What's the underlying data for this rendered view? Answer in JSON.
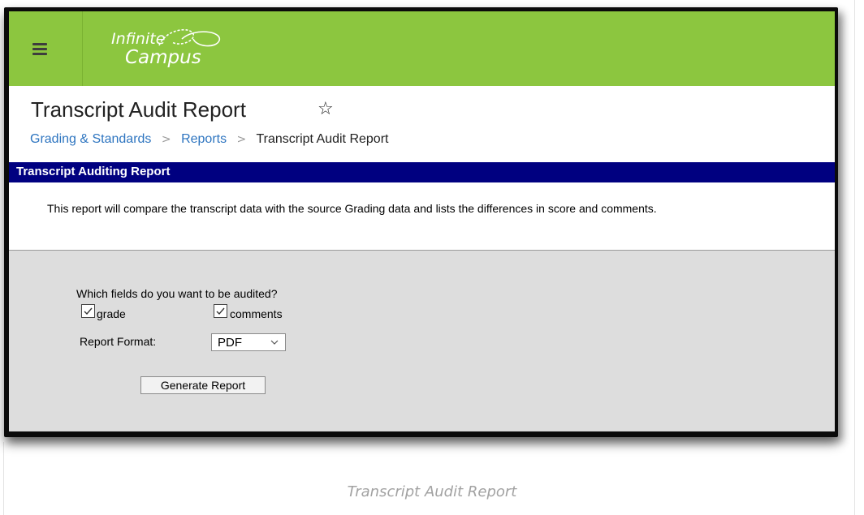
{
  "header": {
    "logo_line1": "Infinite",
    "logo_line2": "Campus"
  },
  "page": {
    "title": "Transcript Audit Report",
    "breadcrumb": [
      "Grading & Standards",
      "Reports",
      "Transcript Audit Report"
    ]
  },
  "section": {
    "title": "Transcript Auditing Report",
    "description": "This report will compare the transcript data with the source Grading data and lists the differences in score and comments."
  },
  "form": {
    "question": "Which fields do you want to be audited?",
    "grade_label": "grade",
    "grade_checked": true,
    "comments_label": "comments",
    "comments_checked": true,
    "format_label": "Report Format:",
    "format_value": "PDF",
    "generate_label": "Generate Report"
  },
  "caption": "Transcript Audit Report",
  "colors": {
    "topbar": "#8cc63f",
    "section_header": "#000080",
    "link": "#2e75c0",
    "form_background": "#dddddd"
  },
  "icons": {
    "menu": "hamburger-icon",
    "favorite": "star-outline-icon",
    "separator": "chevron-right-icon",
    "dropdown": "chevron-down-icon",
    "check": "checkmark-icon"
  }
}
